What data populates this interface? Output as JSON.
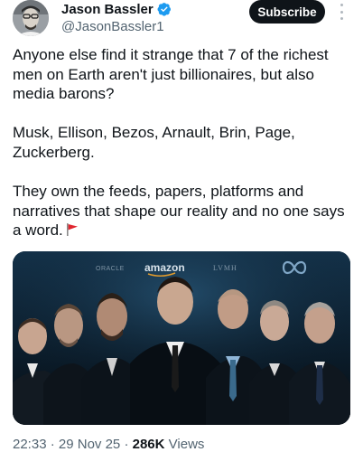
{
  "author": {
    "display_name": "Jason Bassler",
    "handle": "@JasonBassler1",
    "verified": true,
    "verified_color": "#1d9bf0"
  },
  "actions": {
    "subscribe_label": "Subscribe",
    "more_icon": "more-vertical-icon"
  },
  "tweet": {
    "text": "Anyone else find it strange that 7 of the richest men on Earth aren't just billionaires, but also media barons?\n\nMusk, Ellison, Bezos, Arnault, Brin, Page, Zuckerberg.\n\nThey own the feeds, papers, platforms and narratives that shape our reality and no one says a word.",
    "emoji": "red-flag-emoji"
  },
  "media": {
    "logos": {
      "oracle": "ORACLE",
      "amazon": "amazon",
      "lvmh": "LVMH",
      "meta": "meta-infinity-logo"
    }
  },
  "meta": {
    "time": "22:33",
    "date": "29 Nov 25",
    "views_count": "286K",
    "views_label": "Views"
  }
}
